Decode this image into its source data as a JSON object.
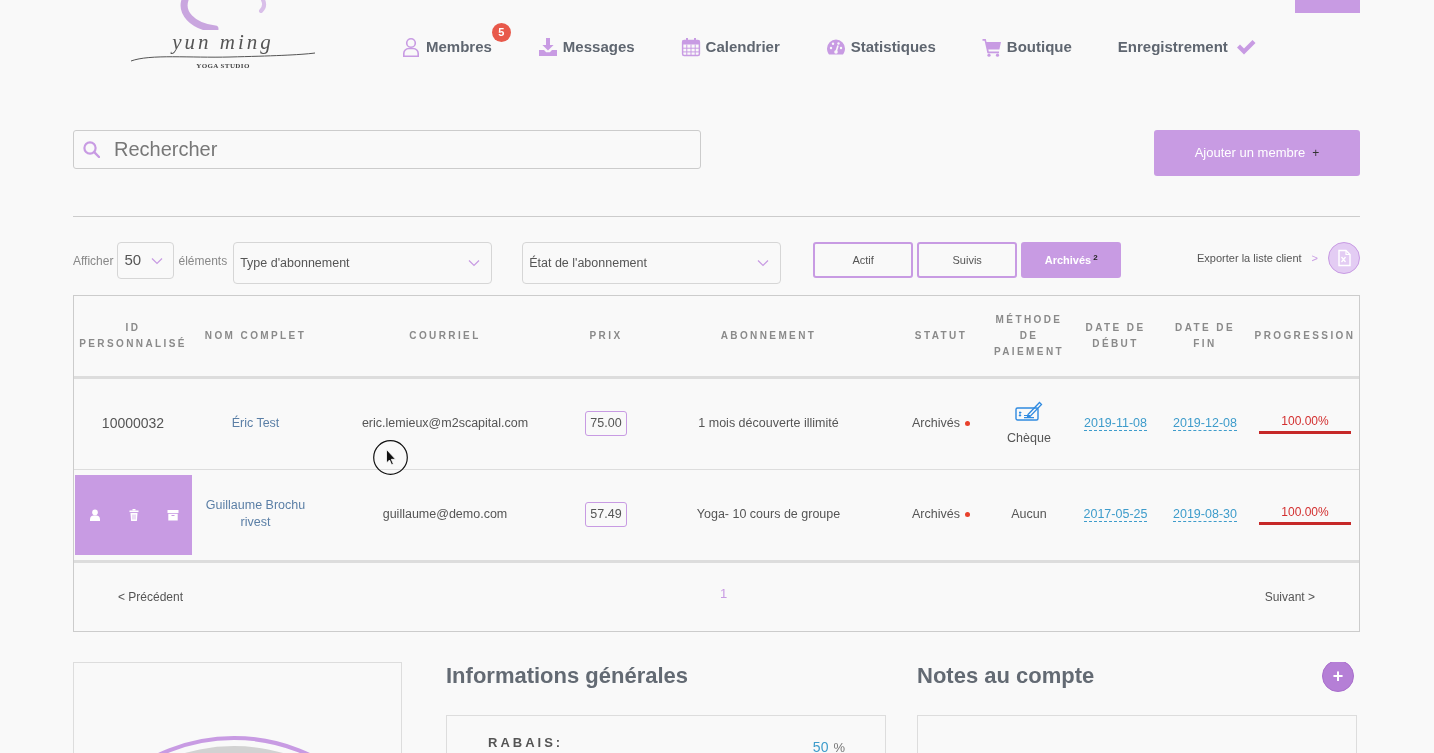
{
  "logo": {
    "name": "yun ming",
    "tagline": "YOGA STUDIO"
  },
  "nav": [
    {
      "label": "Membres",
      "badge": "5"
    },
    {
      "label": "Messages"
    },
    {
      "label": "Calendrier"
    },
    {
      "label": "Statistiques"
    },
    {
      "label": "Boutique"
    },
    {
      "label": "Enregistrement"
    }
  ],
  "search": {
    "placeholder": "Rechercher"
  },
  "add_member": {
    "label": "Ajouter un membre",
    "symbol": "+"
  },
  "filters": {
    "show_label": "Afficher",
    "page_size": "50",
    "items_label": "éléments",
    "subscription_type": "Type d'abonnement",
    "subscription_state": "État de l'abonnement"
  },
  "status_tabs": [
    {
      "label": "Actif",
      "selected": false
    },
    {
      "label": "Suivis",
      "selected": false
    },
    {
      "label": "Archivés",
      "count": "2",
      "selected": true
    }
  ],
  "export": {
    "label": "Exporter la liste client",
    "arrow": ">"
  },
  "table": {
    "columns": [
      "ID PERSONNALISÉ",
      "NOM COMPLET",
      "COURRIEL",
      "PRIX",
      "ABONNEMENT",
      "STATUT",
      "MÉTHODE DE PAIEMENT",
      "DATE DE DÉBUT",
      "DATE DE FIN",
      "PROGRESSION"
    ],
    "rows": [
      {
        "hovered": false,
        "id": "10000032",
        "name": "Éric Test",
        "email": "eric.lemieux@m2scapital.com",
        "price": "75.00",
        "subscription": "1 mois découverte illimité",
        "status": "Archivés",
        "color": "#e8412c",
        "payment": {
          "kind": "cheque",
          "label": "Chèque"
        },
        "start": "2019-11-08",
        "end": "2019-12-08",
        "progress": {
          "reading": "100.00%",
          "level": 1
        }
      },
      {
        "hovered": true,
        "name": "Guillaume Brochu rivest",
        "email": "guillaume@demo.com",
        "price": "57.49",
        "subscription": "Yoga- 10 cours de groupe",
        "status": "Archivés",
        "color": "#e8412c",
        "payment": {
          "kind": "none",
          "label": "Aucun"
        },
        "start": "2017-05-25",
        "end": "2019-08-30",
        "progress": {
          "reading": "100.00%",
          "level": 1
        }
      }
    ]
  },
  "pagination": {
    "previous": "< Précédent",
    "pages": [
      {
        "label": "1",
        "selected": true
      }
    ],
    "next": "Suivant >"
  },
  "general_info": {
    "title": "Informations générales",
    "fields": [
      {
        "label": "RABAIS:",
        "value": "50",
        "unit": "%"
      }
    ]
  },
  "account_notes": {
    "title": "Notes au compte",
    "add": "+"
  }
}
